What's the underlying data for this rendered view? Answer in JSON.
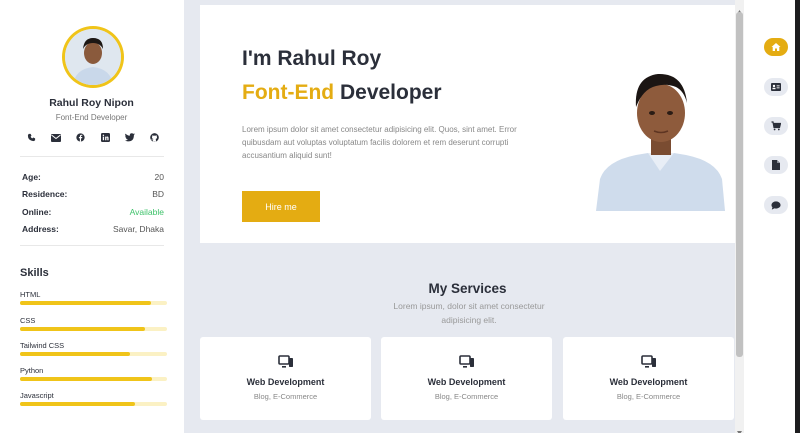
{
  "profile": {
    "name": "Rahul Roy Nipon",
    "role": "Font-End Developer",
    "socials": [
      "phone-icon",
      "mail-icon",
      "facebook-icon",
      "linkedin-icon",
      "twitter-icon",
      "github-icon"
    ]
  },
  "info": [
    {
      "label": "Age:",
      "value": "20"
    },
    {
      "label": "Residence:",
      "value": "BD"
    },
    {
      "label": "Online:",
      "value": "Available"
    },
    {
      "label": "Address:",
      "value": "Savar, Dhaka"
    }
  ],
  "skills": {
    "title": "Skills",
    "items": [
      {
        "name": "HTML",
        "level": 0.89
      },
      {
        "name": "CSS",
        "level": 0.85
      },
      {
        "name": "Tailwind CSS",
        "level": 0.75
      },
      {
        "name": "Python",
        "level": 0.9
      },
      {
        "name": "Javascript",
        "level": 0.78
      }
    ]
  },
  "hero": {
    "greeting": "I'm Rahul Roy",
    "title_accent": "Font-End",
    "title_rest": " Developer",
    "description": "Lorem ipsum dolor sit amet consectetur adipisicing elit. Quos, sint amet. Error quibusdam aut voluptas voluptatum facilis dolorem et rem deserunt corrupti accusantium aliquid sunt!",
    "button": "Hire me"
  },
  "services": {
    "title": "My Services",
    "subtitle": "Lorem ipsum, dolor sit amet consectetur adipisicing elit.",
    "cards": [
      {
        "icon": "devices-icon",
        "title": "Web Development",
        "subtitle": "Blog, E-Commerce"
      },
      {
        "icon": "devices-icon",
        "title": "Web Development",
        "subtitle": "Blog, E-Commerce"
      },
      {
        "icon": "devices-icon",
        "title": "Web Development",
        "subtitle": "Blog, E-Commerce"
      }
    ]
  },
  "rightnav": [
    {
      "icon": "home-icon",
      "active": true
    },
    {
      "icon": "id-card-icon",
      "active": false
    },
    {
      "icon": "cart-icon",
      "active": false
    },
    {
      "icon": "document-icon",
      "active": false
    },
    {
      "icon": "chat-icon",
      "active": false
    }
  ],
  "colors": {
    "accent": "#e4ac12",
    "online": "#3ec26a",
    "background": "#e6e9f0"
  }
}
